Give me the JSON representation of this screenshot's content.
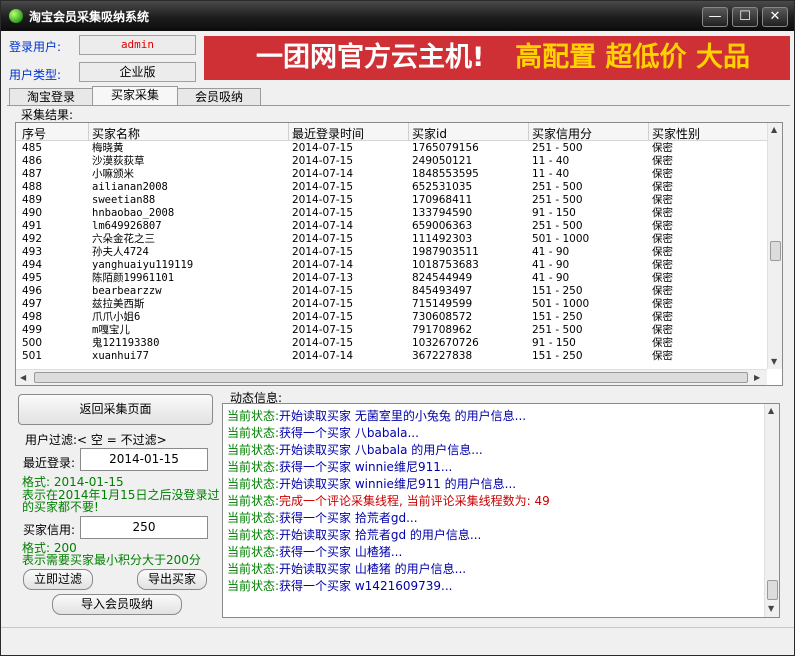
{
  "window": {
    "title": "淘宝会员采集吸纳系统",
    "minimize": "—",
    "maximize": "☐",
    "close": "✕"
  },
  "login": {
    "user_label": "登录用户:",
    "user_value": "admin",
    "type_label": "用户类型:",
    "type_value": "企业版"
  },
  "banner": {
    "part1": "一团网官方云主机!",
    "part2": "高配置 超低价 大品"
  },
  "tabs": [
    "淘宝登录",
    "买家采集",
    "会员吸纳"
  ],
  "results_label": "采集结果:",
  "table": {
    "columns": [
      "序号",
      "买家名称",
      "最近登录时间",
      "买家id",
      "买家信用分",
      "买家性别"
    ],
    "rows": [
      [
        "485",
        "梅晓黄",
        "2014-07-15",
        "1765079156",
        "251 - 500",
        "保密"
      ],
      [
        "486",
        "沙漠荻荻草",
        "2014-07-15",
        "249050121",
        "11 - 40",
        "保密"
      ],
      [
        "487",
        "小嘛颁米",
        "2014-07-14",
        "1848553595",
        "11 - 40",
        "保密"
      ],
      [
        "488",
        "ailianan2008",
        "2014-07-15",
        "652531035",
        "251 - 500",
        "保密"
      ],
      [
        "489",
        "sweetian88",
        "2014-07-15",
        "170968411",
        "251 - 500",
        "保密"
      ],
      [
        "490",
        "hnbaobao_2008",
        "2014-07-15",
        "133794590",
        "91 - 150",
        "保密"
      ],
      [
        "491",
        "lm649926807",
        "2014-07-14",
        "659006363",
        "251 - 500",
        "保密"
      ],
      [
        "492",
        "六朵金花之三",
        "2014-07-15",
        "111492303",
        "501 - 1000",
        "保密"
      ],
      [
        "493",
        "孙夫人4724",
        "2014-07-15",
        "1987903511",
        "41 - 90",
        "保密"
      ],
      [
        "494",
        "yanghuaiyu119119",
        "2014-07-14",
        "1018753683",
        "41 - 90",
        "保密"
      ],
      [
        "495",
        "陈陌颜19961101",
        "2014-07-13",
        "824544949",
        "41 - 90",
        "保密"
      ],
      [
        "496",
        "bearbearzzw",
        "2014-07-15",
        "845493497",
        "151 - 250",
        "保密"
      ],
      [
        "497",
        "兹拉美西斯",
        "2014-07-15",
        "715149599",
        "501 - 1000",
        "保密"
      ],
      [
        "498",
        "爪爪小姐6",
        "2014-07-15",
        "730608572",
        "151 - 250",
        "保密"
      ],
      [
        "499",
        "m嘎宝儿",
        "2014-07-15",
        "791708962",
        "251 - 500",
        "保密"
      ],
      [
        "500",
        "鬼121193380",
        "2014-07-15",
        "1032670726",
        "91 - 150",
        "保密"
      ],
      [
        "501",
        "xuanhui77",
        "2014-07-14",
        "367227838",
        "151 - 250",
        "保密"
      ]
    ]
  },
  "left_panel": {
    "back_button": "返回采集页面",
    "user_filter_label": "用户过滤:< 空 = 不过滤>",
    "recent_login_label": "最近登录:",
    "recent_login_value": "2014-01-15",
    "format_line1": "格式: 2014-01-15",
    "format_line2": "表示在2014年1月15日之后没登录过",
    "format_line3": "的买家都不要!",
    "credit_label": "买家信用:",
    "credit_value": "250",
    "credit_format1": "格式: 200",
    "credit_format2": "表示需要买家最小积分大于200分",
    "filter_button": "立即过滤",
    "export_button": "导出买家",
    "import_button": "导入会员吸纳"
  },
  "log": {
    "label": "动态信息:",
    "lines": [
      {
        "prefix": "当前状态:",
        "text": "开始读取买家 无菌室里的小兔兔 的用户信息...",
        "color": "#0000aa"
      },
      {
        "prefix": "当前状态:",
        "text": "获得一个买家 八babala...",
        "color": "#0000aa"
      },
      {
        "prefix": "当前状态:",
        "text": "开始读取买家 八babala 的用户信息...",
        "color": "#0000aa"
      },
      {
        "prefix": "当前状态:",
        "text": "获得一个买家 winnie维尼911...",
        "color": "#0000aa"
      },
      {
        "prefix": "当前状态:",
        "text": "开始读取买家 winnie维尼911 的用户信息...",
        "color": "#0000aa"
      },
      {
        "prefix": "当前状态:",
        "text": "完成一个评论采集线程, 当前评论采集线程数为: 49",
        "color": "#cc0000"
      },
      {
        "prefix": "当前状态:",
        "text": "获得一个买家 拾荒者gd...",
        "color": "#0000aa"
      },
      {
        "prefix": "当前状态:",
        "text": "开始读取买家 拾荒者gd 的用户信息...",
        "color": "#0000aa"
      },
      {
        "prefix": "当前状态:",
        "text": "获得一个买家 山楂猪...",
        "color": "#0000aa"
      },
      {
        "prefix": "当前状态:",
        "text": "开始读取买家 山楂猪 的用户信息...",
        "color": "#0000aa"
      },
      {
        "prefix": "当前状态:",
        "text": "获得一个买家 w1421609739...",
        "color": "#0000aa"
      }
    ]
  },
  "colors": {
    "prefix_green": "#008000",
    "banner_bg": "#cf3036",
    "banner_highlight": "#ffd200"
  }
}
